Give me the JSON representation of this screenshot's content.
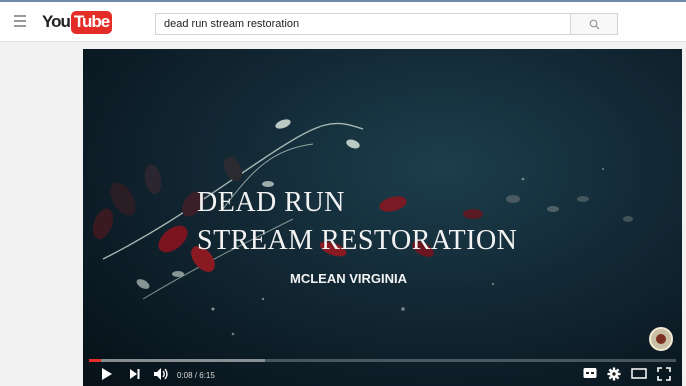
{
  "search": {
    "query": "dead run stream restoration"
  },
  "logo": {
    "you": "You",
    "tube": "Tube"
  },
  "video": {
    "title_line1": "DEAD RUN",
    "title_line2": "STREAM RESTORATION",
    "subtitle": "MCLEAN VIRGINIA",
    "time_display": "0:08 / 6:15",
    "played_fraction": 0.021,
    "buffered_fraction": 0.3
  },
  "colors": {
    "accent": "#e52d27",
    "player_bg": "#0b1c26"
  },
  "icons": {
    "menu": "hamburger-icon",
    "search": "search-icon",
    "play": "play-icon",
    "next": "next-icon",
    "volume": "volume-icon",
    "captions": "captions-icon",
    "settings": "gear-icon",
    "theater": "theater-mode-icon",
    "fullscreen": "fullscreen-icon"
  }
}
